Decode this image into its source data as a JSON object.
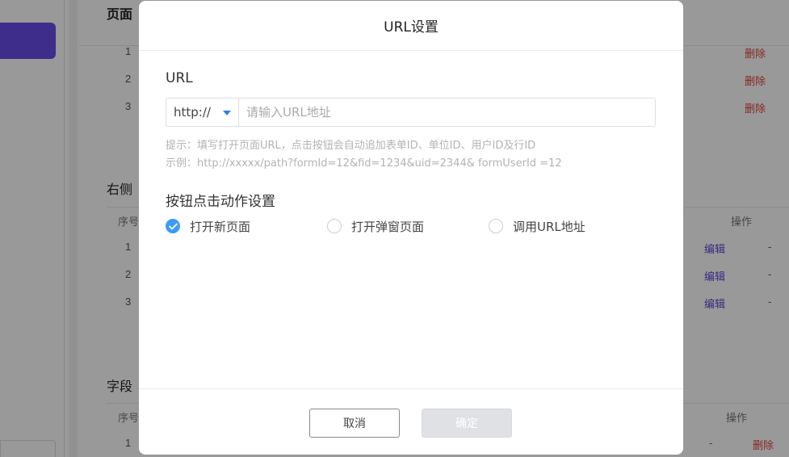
{
  "background": {
    "section1_title": "页面",
    "section1_rows": [
      {
        "index": "1",
        "action": "删除"
      },
      {
        "index": "2",
        "action": "删除"
      },
      {
        "index": "3",
        "action": "删除"
      }
    ],
    "section2_title": "右侧",
    "section2_head_index": "序号",
    "section2_head_ops": "操作",
    "section2_rows": [
      {
        "index": "1",
        "edit": "编辑",
        "dash": "-"
      },
      {
        "index": "2",
        "edit": "编辑",
        "dash": "-"
      },
      {
        "index": "3",
        "edit": "编辑",
        "dash": "-"
      }
    ],
    "section3_title": "字段",
    "section3_head_index": "序号",
    "section3_head_ops": "操作",
    "section3_rows": [
      {
        "index": "1",
        "dash": "-",
        "action": "删除"
      }
    ]
  },
  "modal": {
    "title": "URL设置",
    "url_label": "URL",
    "protocol_value": "http://",
    "url_placeholder": "请输入URL地址",
    "url_value": "",
    "hint_line1": "提示：填写打开页面URL，点击按钮会自动追加表单ID、单位ID、用户ID及行ID",
    "hint_line2": "示例：http://xxxxx/path?formId=12&fid=1234&uid=2344& formUserId =12",
    "action_label": "按钮点击动作设置",
    "options": [
      {
        "label": "打开新页面",
        "checked": true
      },
      {
        "label": "打开弹窗页面",
        "checked": false
      },
      {
        "label": "调用URL地址",
        "checked": false
      }
    ],
    "cancel_label": "取消",
    "ok_label": "确定"
  },
  "colors": {
    "accent": "#3d9bf5",
    "primary_purple": "#6a4ce8",
    "danger": "#e0433a"
  }
}
